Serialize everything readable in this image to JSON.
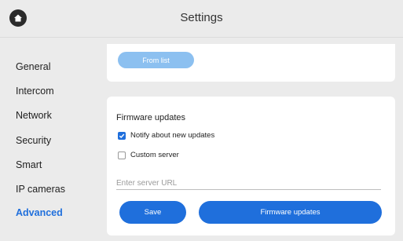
{
  "header": {
    "title": "Settings",
    "home_icon": "home-icon"
  },
  "sidebar": {
    "items": [
      {
        "label": "General",
        "active": false
      },
      {
        "label": "Intercom",
        "active": false
      },
      {
        "label": "Network",
        "active": false
      },
      {
        "label": "Security",
        "active": false
      },
      {
        "label": "Smart",
        "active": false
      },
      {
        "label": "IP cameras",
        "active": false
      },
      {
        "label": "Advanced",
        "active": true
      }
    ]
  },
  "top_card": {
    "from_list_label": "From list"
  },
  "firmware": {
    "title": "Firmware updates",
    "notify_label": "Notify about new updates",
    "notify_checked": true,
    "custom_server_label": "Custom server",
    "custom_server_checked": false,
    "server_url_placeholder": "Enter server URL",
    "server_url_value": "",
    "save_label": "Save",
    "firmware_updates_label": "Firmware updates"
  },
  "colors": {
    "accent": "#1f6fdc",
    "accent_light": "#8cc0f0",
    "background": "#ebebeb"
  }
}
